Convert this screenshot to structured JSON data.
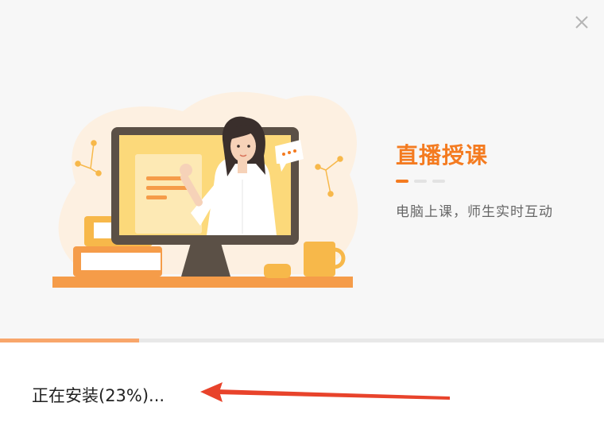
{
  "window": {
    "close_icon": "close-icon"
  },
  "slide": {
    "title": "直播授课",
    "subtitle": "电脑上课，师生实时互动",
    "dots_count": 3,
    "active_dot": 0
  },
  "install": {
    "status_text": "正在安装(23%)...",
    "progress": 0.23
  },
  "colors": {
    "accent": "#f47b20",
    "progress_fill": "#f8a66b",
    "annotation_arrow": "#e8432b"
  }
}
